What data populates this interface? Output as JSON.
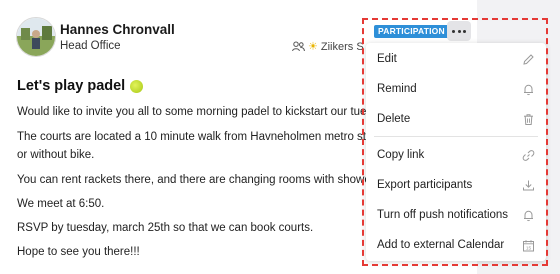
{
  "author": {
    "name": "Hannes Chronvall",
    "office": "Head Office"
  },
  "audience": {
    "icon": "group-icon",
    "label": "Ziikers S"
  },
  "tag": {
    "label": "PARTICIPATION",
    "color": "#2e8fd8"
  },
  "post": {
    "title": "Let's play padel",
    "paragraphs": [
      "Would like to invite you all to some morning padel to kickstart our tuesday o",
      "The courts are located a 10 minute walk from Havneholmen metro st, so it's",
      "or without bike.",
      "You can rent rackets there, and there are changing rooms with showers avail",
      "We meet at 6:50.",
      "RSVP by tuesday, march 25th so that we can book courts.",
      "Hope to see you there!!!"
    ]
  },
  "menu": {
    "items": [
      {
        "label": "Edit",
        "icon": "pencil-icon"
      },
      {
        "label": "Remind",
        "icon": "bell-icon"
      },
      {
        "label": "Delete",
        "icon": "trash-icon"
      },
      {
        "label": "Copy link",
        "icon": "link-icon"
      },
      {
        "label": "Export participants",
        "icon": "download-icon"
      },
      {
        "label": "Turn off push notifications",
        "icon": "bell-icon"
      },
      {
        "label": "Add to external Calendar",
        "icon": "calendar-icon",
        "icon_text": "15"
      }
    ]
  },
  "colors": {
    "highlight_border": "#e53935",
    "accent": "#2e8fd8"
  }
}
